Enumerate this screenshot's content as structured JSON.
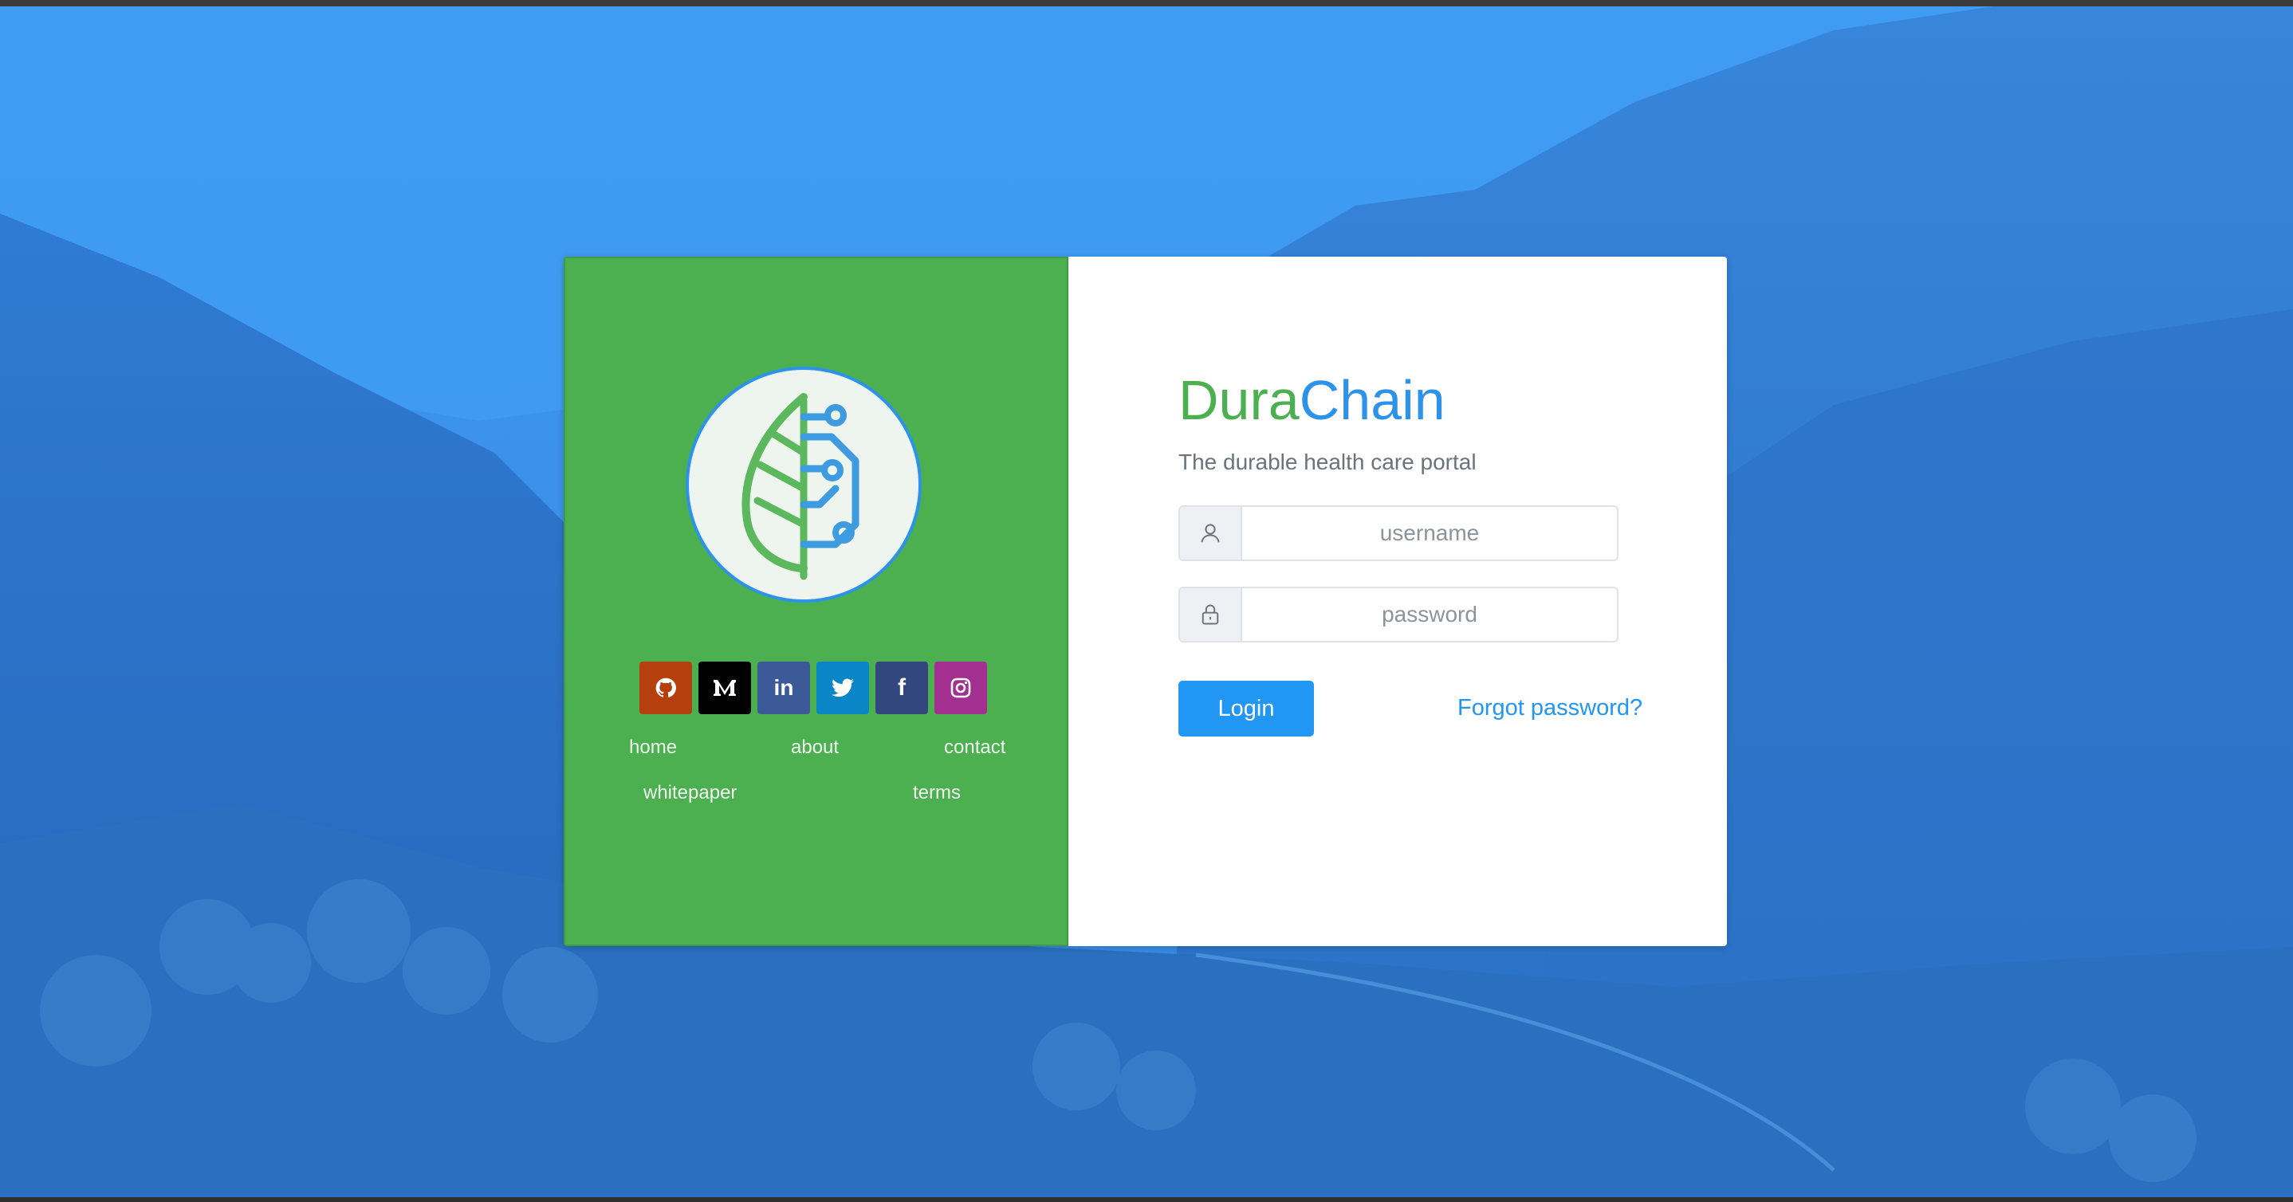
{
  "brand": {
    "part1": "Dura",
    "part2": "Chain",
    "tagline": "The durable health care portal",
    "colors": {
      "green": "#4caf50",
      "blue": "#2d93ea"
    }
  },
  "logo": {
    "icon": "leaf-circuit-icon"
  },
  "social": [
    {
      "name": "github",
      "icon": "github-icon",
      "color": "#b5400e"
    },
    {
      "name": "medium",
      "icon": "medium-icon",
      "color": "#000000"
    },
    {
      "name": "linkedin",
      "icon": "linkedin-icon",
      "color": "#3d5a98"
    },
    {
      "name": "twitter",
      "icon": "twitter-icon",
      "color": "#0a86c6"
    },
    {
      "name": "facebook",
      "icon": "facebook-icon",
      "color": "#33477f"
    },
    {
      "name": "instagram",
      "icon": "instagram-icon",
      "color": "#a32f90"
    }
  ],
  "footer_links": {
    "home": "home",
    "about": "about",
    "contact": "contact",
    "whitepaper": "whitepaper",
    "terms": "terms"
  },
  "form": {
    "username_placeholder": "username",
    "password_placeholder": "password",
    "username_icon": "user-icon",
    "password_icon": "lock-icon",
    "login_label": "Login",
    "forgot_label": "Forgot password?"
  }
}
